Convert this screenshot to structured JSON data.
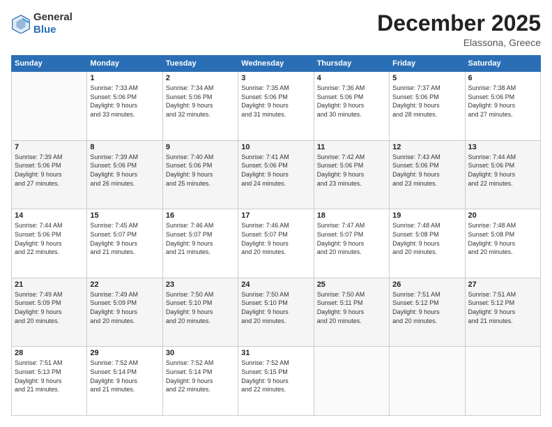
{
  "logo": {
    "general": "General",
    "blue": "Blue"
  },
  "title": "December 2025",
  "location": "Elassona, Greece",
  "days_of_week": [
    "Sunday",
    "Monday",
    "Tuesday",
    "Wednesday",
    "Thursday",
    "Friday",
    "Saturday"
  ],
  "weeks": [
    [
      {
        "day": "",
        "info": ""
      },
      {
        "day": "1",
        "info": "Sunrise: 7:33 AM\nSunset: 5:06 PM\nDaylight: 9 hours\nand 33 minutes."
      },
      {
        "day": "2",
        "info": "Sunrise: 7:34 AM\nSunset: 5:06 PM\nDaylight: 9 hours\nand 32 minutes."
      },
      {
        "day": "3",
        "info": "Sunrise: 7:35 AM\nSunset: 5:06 PM\nDaylight: 9 hours\nand 31 minutes."
      },
      {
        "day": "4",
        "info": "Sunrise: 7:36 AM\nSunset: 5:06 PM\nDaylight: 9 hours\nand 30 minutes."
      },
      {
        "day": "5",
        "info": "Sunrise: 7:37 AM\nSunset: 5:06 PM\nDaylight: 9 hours\nand 28 minutes."
      },
      {
        "day": "6",
        "info": "Sunrise: 7:38 AM\nSunset: 5:06 PM\nDaylight: 9 hours\nand 27 minutes."
      }
    ],
    [
      {
        "day": "7",
        "info": "Sunrise: 7:39 AM\nSunset: 5:06 PM\nDaylight: 9 hours\nand 27 minutes."
      },
      {
        "day": "8",
        "info": "Sunrise: 7:39 AM\nSunset: 5:06 PM\nDaylight: 9 hours\nand 26 minutes."
      },
      {
        "day": "9",
        "info": "Sunrise: 7:40 AM\nSunset: 5:06 PM\nDaylight: 9 hours\nand 25 minutes."
      },
      {
        "day": "10",
        "info": "Sunrise: 7:41 AM\nSunset: 5:06 PM\nDaylight: 9 hours\nand 24 minutes."
      },
      {
        "day": "11",
        "info": "Sunrise: 7:42 AM\nSunset: 5:06 PM\nDaylight: 9 hours\nand 23 minutes."
      },
      {
        "day": "12",
        "info": "Sunrise: 7:43 AM\nSunset: 5:06 PM\nDaylight: 9 hours\nand 23 minutes."
      },
      {
        "day": "13",
        "info": "Sunrise: 7:44 AM\nSunset: 5:06 PM\nDaylight: 9 hours\nand 22 minutes."
      }
    ],
    [
      {
        "day": "14",
        "info": "Sunrise: 7:44 AM\nSunset: 5:06 PM\nDaylight: 9 hours\nand 22 minutes."
      },
      {
        "day": "15",
        "info": "Sunrise: 7:45 AM\nSunset: 5:07 PM\nDaylight: 9 hours\nand 21 minutes."
      },
      {
        "day": "16",
        "info": "Sunrise: 7:46 AM\nSunset: 5:07 PM\nDaylight: 9 hours\nand 21 minutes."
      },
      {
        "day": "17",
        "info": "Sunrise: 7:46 AM\nSunset: 5:07 PM\nDaylight: 9 hours\nand 20 minutes."
      },
      {
        "day": "18",
        "info": "Sunrise: 7:47 AM\nSunset: 5:07 PM\nDaylight: 9 hours\nand 20 minutes."
      },
      {
        "day": "19",
        "info": "Sunrise: 7:48 AM\nSunset: 5:08 PM\nDaylight: 9 hours\nand 20 minutes."
      },
      {
        "day": "20",
        "info": "Sunrise: 7:48 AM\nSunset: 5:08 PM\nDaylight: 9 hours\nand 20 minutes."
      }
    ],
    [
      {
        "day": "21",
        "info": "Sunrise: 7:49 AM\nSunset: 5:09 PM\nDaylight: 9 hours\nand 20 minutes."
      },
      {
        "day": "22",
        "info": "Sunrise: 7:49 AM\nSunset: 5:09 PM\nDaylight: 9 hours\nand 20 minutes."
      },
      {
        "day": "23",
        "info": "Sunrise: 7:50 AM\nSunset: 5:10 PM\nDaylight: 9 hours\nand 20 minutes."
      },
      {
        "day": "24",
        "info": "Sunrise: 7:50 AM\nSunset: 5:10 PM\nDaylight: 9 hours\nand 20 minutes."
      },
      {
        "day": "25",
        "info": "Sunrise: 7:50 AM\nSunset: 5:11 PM\nDaylight: 9 hours\nand 20 minutes."
      },
      {
        "day": "26",
        "info": "Sunrise: 7:51 AM\nSunset: 5:12 PM\nDaylight: 9 hours\nand 20 minutes."
      },
      {
        "day": "27",
        "info": "Sunrise: 7:51 AM\nSunset: 5:12 PM\nDaylight: 9 hours\nand 21 minutes."
      }
    ],
    [
      {
        "day": "28",
        "info": "Sunrise: 7:51 AM\nSunset: 5:13 PM\nDaylight: 9 hours\nand 21 minutes."
      },
      {
        "day": "29",
        "info": "Sunrise: 7:52 AM\nSunset: 5:14 PM\nDaylight: 9 hours\nand 21 minutes."
      },
      {
        "day": "30",
        "info": "Sunrise: 7:52 AM\nSunset: 5:14 PM\nDaylight: 9 hours\nand 22 minutes."
      },
      {
        "day": "31",
        "info": "Sunrise: 7:52 AM\nSunset: 5:15 PM\nDaylight: 9 hours\nand 22 minutes."
      },
      {
        "day": "",
        "info": ""
      },
      {
        "day": "",
        "info": ""
      },
      {
        "day": "",
        "info": ""
      }
    ]
  ]
}
